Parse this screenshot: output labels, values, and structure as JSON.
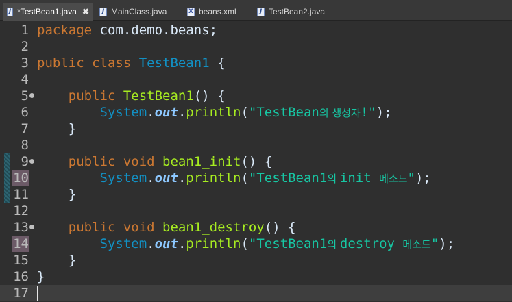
{
  "tabs": [
    {
      "label": "*TestBean1.java",
      "icon": "java-file-icon",
      "active": true,
      "has_close": true
    },
    {
      "label": "MainClass.java",
      "icon": "java-file-icon",
      "active": false,
      "has_close": false
    },
    {
      "label": "beans.xml",
      "icon": "xml-file-icon",
      "active": false,
      "has_close": false
    },
    {
      "label": "TestBean2.java",
      "icon": "java-file-icon",
      "active": false,
      "has_close": false
    }
  ],
  "close_glyph": "✖",
  "file_icon_letters": {
    "java": "J",
    "xml": "X"
  },
  "editor": {
    "current_line": 17,
    "lines": [
      {
        "num": "1",
        "tokens": [
          {
            "t": "package ",
            "c": "kw"
          },
          {
            "t": "com.demo.beans;",
            "c": ""
          }
        ]
      },
      {
        "num": "2",
        "tokens": []
      },
      {
        "num": "3",
        "tokens": [
          {
            "t": "public class ",
            "c": "kw"
          },
          {
            "t": "TestBean1",
            "c": "cls"
          },
          {
            "t": " {",
            "c": ""
          }
        ]
      },
      {
        "num": "4",
        "tokens": []
      },
      {
        "num": "5",
        "fold": true,
        "tokens": [
          {
            "t": "    public ",
            "c": "kw"
          },
          {
            "t": "TestBean1",
            "c": "mth"
          },
          {
            "t": "() {",
            "c": ""
          }
        ]
      },
      {
        "num": "6",
        "tokens": [
          {
            "t": "        System",
            "c": "cls"
          },
          {
            "t": ".",
            "c": ""
          },
          {
            "t": "out",
            "c": "fld"
          },
          {
            "t": ".",
            "c": ""
          },
          {
            "t": "println",
            "c": "mth"
          },
          {
            "t": "(",
            "c": ""
          },
          {
            "t": "\"TestBean",
            "c": "str"
          },
          {
            "t": "의 생성자",
            "c": "str ko"
          },
          {
            "t": "!\"",
            "c": "str"
          },
          {
            "t": ");",
            "c": ""
          }
        ]
      },
      {
        "num": "7",
        "tokens": [
          {
            "t": "    }",
            "c": ""
          }
        ]
      },
      {
        "num": "8",
        "tokens": []
      },
      {
        "num": "9",
        "fold": true,
        "tokens": [
          {
            "t": "    public void ",
            "c": "kw"
          },
          {
            "t": "bean1_init",
            "c": "mth"
          },
          {
            "t": "() {",
            "c": ""
          }
        ]
      },
      {
        "num": "10",
        "num_highlight": true,
        "tokens": [
          {
            "t": "        System",
            "c": "cls"
          },
          {
            "t": ".",
            "c": ""
          },
          {
            "t": "out",
            "c": "fld"
          },
          {
            "t": ".",
            "c": ""
          },
          {
            "t": "println",
            "c": "mth"
          },
          {
            "t": "(",
            "c": ""
          },
          {
            "t": "\"TestBean1",
            "c": "str"
          },
          {
            "t": "의 ",
            "c": "str ko"
          },
          {
            "t": "init ",
            "c": "str"
          },
          {
            "t": "메소드",
            "c": "str ko"
          },
          {
            "t": "\"",
            "c": "str"
          },
          {
            "t": ");",
            "c": ""
          }
        ]
      },
      {
        "num": "11",
        "tokens": [
          {
            "t": "    }",
            "c": ""
          }
        ]
      },
      {
        "num": "12",
        "tokens": []
      },
      {
        "num": "13",
        "fold": true,
        "tokens": [
          {
            "t": "    public void ",
            "c": "kw"
          },
          {
            "t": "bean1_destroy",
            "c": "mth"
          },
          {
            "t": "() {",
            "c": ""
          }
        ]
      },
      {
        "num": "14",
        "num_highlight": true,
        "tokens": [
          {
            "t": "        System",
            "c": "cls"
          },
          {
            "t": ".",
            "c": ""
          },
          {
            "t": "out",
            "c": "fld"
          },
          {
            "t": ".",
            "c": ""
          },
          {
            "t": "println",
            "c": "mth"
          },
          {
            "t": "(",
            "c": ""
          },
          {
            "t": "\"TestBean1",
            "c": "str"
          },
          {
            "t": "의 ",
            "c": "str ko"
          },
          {
            "t": "destroy ",
            "c": "str"
          },
          {
            "t": "메소드",
            "c": "str ko"
          },
          {
            "t": "\"",
            "c": "str"
          },
          {
            "t": ");",
            "c": ""
          }
        ]
      },
      {
        "num": "15",
        "tokens": [
          {
            "t": "    }",
            "c": ""
          }
        ]
      },
      {
        "num": "16",
        "tokens": [
          {
            "t": "}",
            "c": ""
          }
        ]
      },
      {
        "num": "17",
        "tokens": []
      }
    ]
  },
  "colors": {
    "keyword": "#cc7832",
    "class": "#1290c3",
    "method": "#a7ec21",
    "field": "#8dc8ff",
    "string": "#17c6a3",
    "default": "#d9e8f7",
    "background": "#2f2f2f"
  }
}
